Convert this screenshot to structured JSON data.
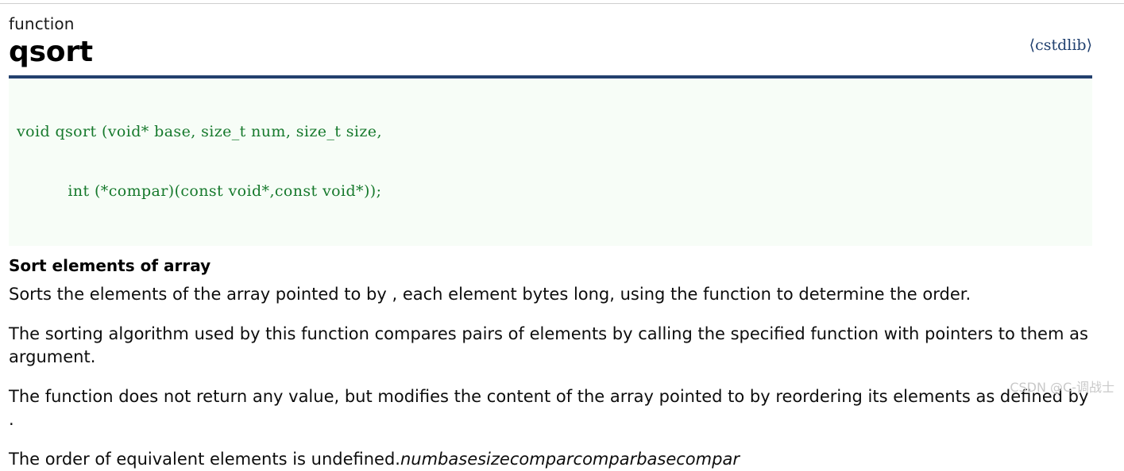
{
  "header": {
    "kind_label": "function",
    "function_name": "qsort",
    "include_header": "⟨cstdlib⟩"
  },
  "prototype": {
    "lines": [
      "void qsort (void* base, size_t num, size_t size,",
      "          int (*compar)(const void*,const void*));"
    ]
  },
  "body": {
    "section_heading": "Sort elements of array",
    "paragraphs": [
      "Sorts the elements of the array pointed to by , each element bytes long, using the function to determine the order.",
      "The sorting algorithm used by this function compares pairs of elements by calling the specified function with pointers to them as argument.",
      "The function does not return any value, but modifies the content of the array pointed to by reordering its elements as defined by ."
    ],
    "final_paragraph": {
      "text": "The order of equivalent elements is undefined.",
      "param_run": "numbasesizecomparcomparbasecompar"
    }
  },
  "watermark": {
    "text": "CSDN @C-调战士"
  },
  "colors": {
    "rule": "#23406e",
    "code_text": "#16792c",
    "code_background": "#f7fdf7",
    "include_text": "#1f3f6e",
    "watermark_text": "#c9c9c9"
  }
}
